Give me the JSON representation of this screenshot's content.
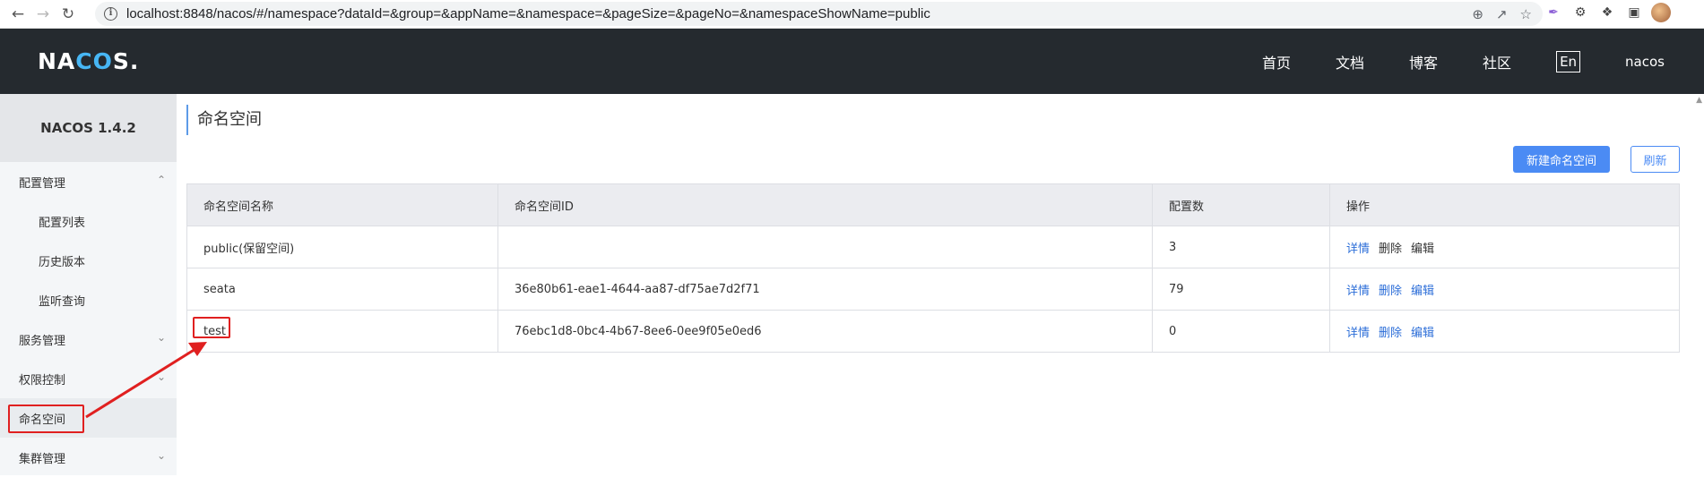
{
  "browser": {
    "url": "localhost:8848/nacos/#/namespace?dataId=&group=&appName=&namespace=&pageSize=&pageNo=&namespaceShowName=public"
  },
  "header": {
    "logo": "NACOS.",
    "nav": [
      "首页",
      "文档",
      "博客",
      "社区"
    ],
    "lang": "En",
    "user": "nacos"
  },
  "sidebar": {
    "version": "NACOS 1.4.2",
    "items": [
      {
        "label": "配置管理",
        "level": 1,
        "chevron": "up"
      },
      {
        "label": "配置列表",
        "level": 2
      },
      {
        "label": "历史版本",
        "level": 2
      },
      {
        "label": "监听查询",
        "level": 2
      },
      {
        "label": "服务管理",
        "level": 1,
        "chevron": "down"
      },
      {
        "label": "权限控制",
        "level": 1,
        "chevron": "down"
      },
      {
        "label": "命名空间",
        "level": 1,
        "active": true
      },
      {
        "label": "集群管理",
        "level": 1,
        "chevron": "down"
      }
    ]
  },
  "main": {
    "title": "命名空间",
    "new_button": "新建命名空间",
    "refresh_button": "刷新",
    "columns": [
      "命名空间名称",
      "命名空间ID",
      "配置数",
      "操作"
    ],
    "rows": [
      {
        "name": "public(保留空间)",
        "id": "",
        "count": "3"
      },
      {
        "name": "seata",
        "id": "36e80b61-eae1-4644-aa87-df75ae7d2f71",
        "count": "79"
      },
      {
        "name": "test",
        "id": "76ebc1d8-0bc4-4b67-8ee6-0ee9f05e0ed6",
        "count": "0"
      }
    ],
    "actions": {
      "detail": "详情",
      "delete": "删除",
      "edit": "编辑"
    }
  },
  "colors": {
    "header_bg": "#252a2f",
    "accent": "#4b8bf4",
    "annotation": "#e02020"
  }
}
